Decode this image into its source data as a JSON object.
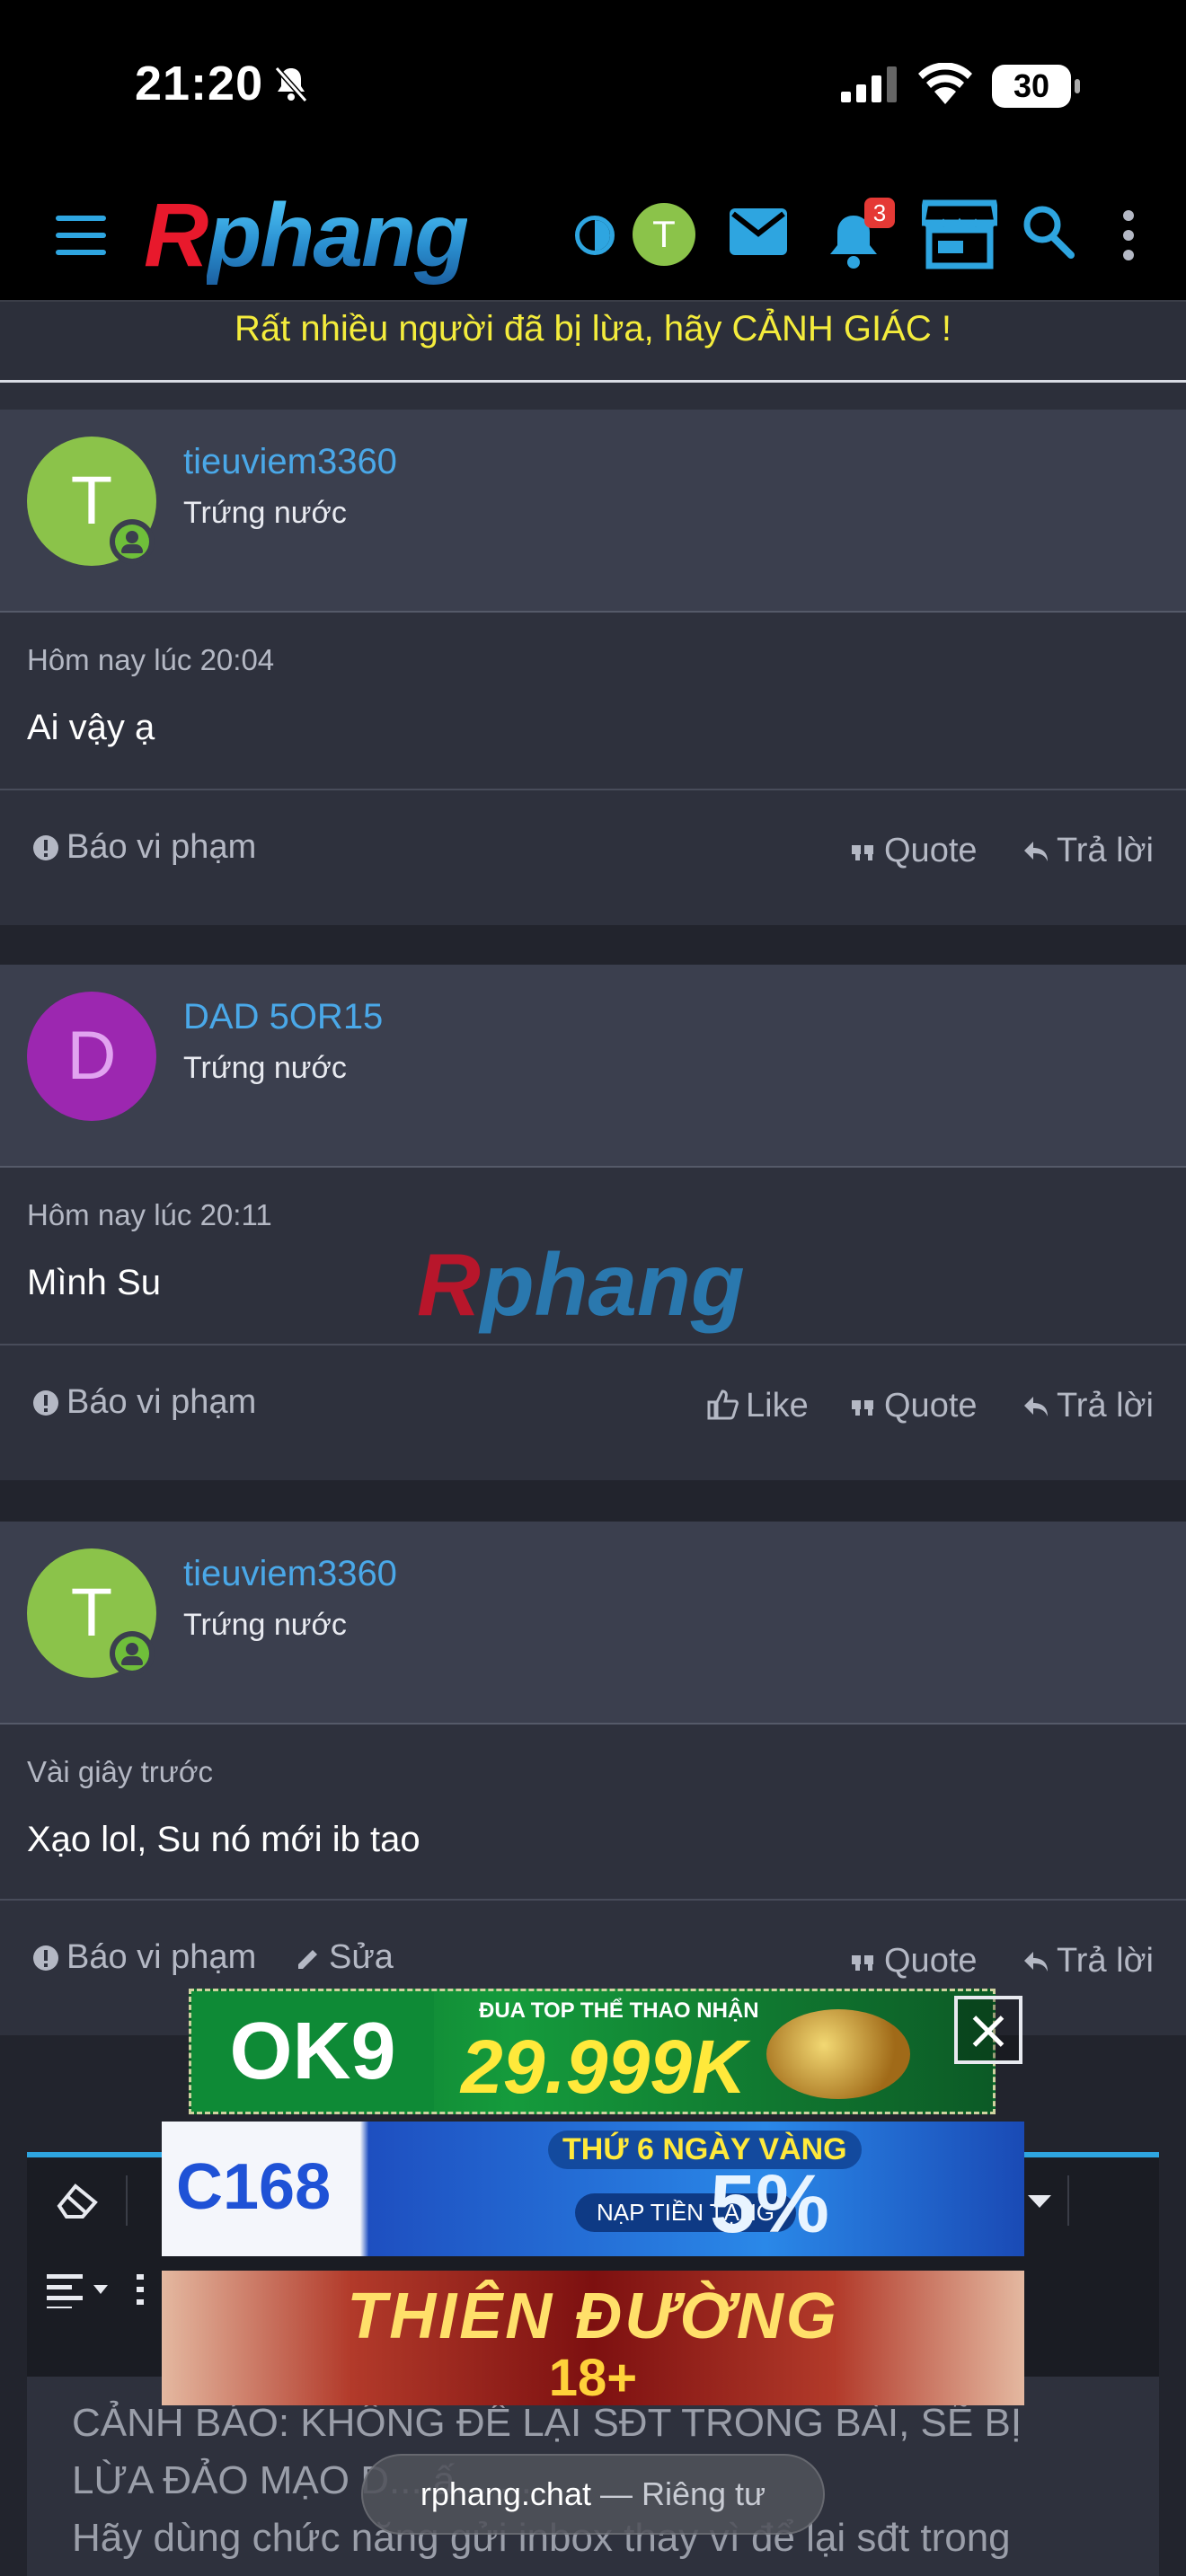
{
  "status_bar": {
    "time": "21:20",
    "battery": "30"
  },
  "nav": {
    "logo_r": "R",
    "logo_rest": "phang",
    "avatar_letter": "T",
    "notification_count": "3"
  },
  "warning": "Rất nhiều người đã bị lừa, hãy CẢNH GIÁC !",
  "posts": [
    {
      "username": "tieuviem3360",
      "user_title": "Trứng nước",
      "avatar_letter": "T",
      "avatar_color": "#8bc34a",
      "time": "Hôm nay lúc 20:04",
      "text": "Ai vậy ạ",
      "report": "Báo vi phạm",
      "quote": "Quote",
      "reply": "Trả lời"
    },
    {
      "username": "DAD 5OR15",
      "user_title": "Trứng nước",
      "avatar_letter": "D",
      "avatar_color": "#9c27b0",
      "time": "Hôm nay lúc 20:11",
      "text": "Mình Su",
      "report": "Báo vi phạm",
      "like": "Like",
      "quote": "Quote",
      "reply": "Trả lời"
    },
    {
      "username": "tieuviem3360",
      "user_title": "Trứng nước",
      "avatar_letter": "T",
      "avatar_color": "#8bc34a",
      "time": "Vài giây trước",
      "text": "Xạo lol, Su nó mới ib tao",
      "report": "Báo vi phạm",
      "edit": "Sửa",
      "quote": "Quote",
      "reply": "Trả lời"
    }
  ],
  "watermark": {
    "r": "R",
    "rest": "phang"
  },
  "editor": {
    "line1": "CẢNH BÁO: KHÔNG ĐỂ LẠI SĐT TRONG BÀI, SẼ BỊ",
    "line2": "LỪA ĐẢO MẠO D... ấ... ...",
    "line3": "Hãy dùng chức năng gửi inbox thay vì để lại sđt trong"
  },
  "ads": {
    "ad1_logo": "OK9",
    "ad1_sub": "ĐUA TOP THỂ THAO NHẬN",
    "ad1_amount": "29.999K",
    "ad2_logo": "C168",
    "ad2_day": "THỨ 6 NGÀY VÀNG",
    "ad2_deposit": "NẠP TIỀN TẶNG",
    "ad2_pct": "5%",
    "ad3_title": "THIÊN ĐƯỜNG",
    "ad3_sub": "18+"
  },
  "url_bar": {
    "host": "rphang.chat",
    "suffix": " — Riêng tư"
  }
}
